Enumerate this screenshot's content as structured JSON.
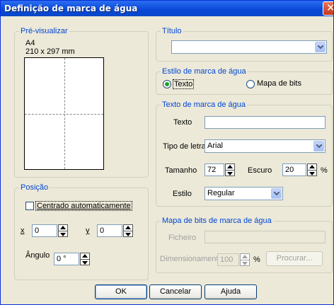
{
  "window": {
    "title": "Definição de marca de água"
  },
  "preview": {
    "legend": "Pré-visualizar",
    "paper": "A4",
    "size": "210 x 297 mm"
  },
  "position": {
    "legend": "Posição",
    "auto_center_label": "Centrado automaticamente",
    "auto_center_checked": false,
    "x_label": "x",
    "x_value": "0",
    "y_label": "y",
    "y_value": "0",
    "angle_label": "Ângulo",
    "angle_value": "0 °"
  },
  "title_group": {
    "legend": "Título",
    "value": ""
  },
  "style_group": {
    "legend": "Estilo de marca de água",
    "option_text": "Texto",
    "option_bitmap": "Mapa de bits",
    "selected": "Texto"
  },
  "text_group": {
    "legend": "Texto de marca de água",
    "text_label": "Texto",
    "text_value": "",
    "font_label": "Tipo de letra",
    "font_value": "Arial",
    "size_label": "Tamanho",
    "size_value": "72",
    "dark_label": "Escuro",
    "dark_value": "20",
    "dark_unit": "%",
    "style_label": "Estilo",
    "style_value": "Regular"
  },
  "bitmap_group": {
    "legend": "Mapa de bits de marca de água",
    "file_label": "Ficheiro",
    "file_value": "",
    "scale_label": "Dimensionamento",
    "scale_value": "100",
    "scale_unit": "%",
    "browse_label": "Procurar..."
  },
  "buttons": {
    "ok": "OK",
    "cancel": "Cancelar",
    "help": "Ajuda"
  },
  "colors": {
    "title_bar": "#0A47D6",
    "dialog_bg": "#ECE9D8",
    "group_label": "#0046D5"
  }
}
